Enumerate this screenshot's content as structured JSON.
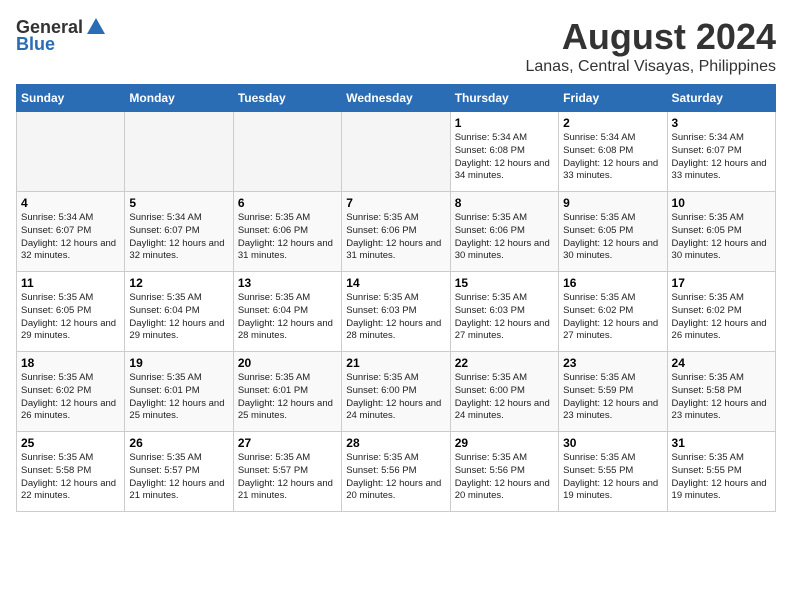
{
  "logo": {
    "general": "General",
    "blue": "Blue"
  },
  "title": "August 2024",
  "location": "Lanas, Central Visayas, Philippines",
  "days_of_week": [
    "Sunday",
    "Monday",
    "Tuesday",
    "Wednesday",
    "Thursday",
    "Friday",
    "Saturday"
  ],
  "weeks": [
    [
      {
        "day": "",
        "empty": true
      },
      {
        "day": "",
        "empty": true
      },
      {
        "day": "",
        "empty": true
      },
      {
        "day": "",
        "empty": true
      },
      {
        "day": "1",
        "sunrise": "5:34 AM",
        "sunset": "6:08 PM",
        "daylight": "12 hours and 34 minutes."
      },
      {
        "day": "2",
        "sunrise": "5:34 AM",
        "sunset": "6:08 PM",
        "daylight": "12 hours and 33 minutes."
      },
      {
        "day": "3",
        "sunrise": "5:34 AM",
        "sunset": "6:07 PM",
        "daylight": "12 hours and 33 minutes."
      }
    ],
    [
      {
        "day": "4",
        "sunrise": "5:34 AM",
        "sunset": "6:07 PM",
        "daylight": "12 hours and 32 minutes."
      },
      {
        "day": "5",
        "sunrise": "5:34 AM",
        "sunset": "6:07 PM",
        "daylight": "12 hours and 32 minutes."
      },
      {
        "day": "6",
        "sunrise": "5:35 AM",
        "sunset": "6:06 PM",
        "daylight": "12 hours and 31 minutes."
      },
      {
        "day": "7",
        "sunrise": "5:35 AM",
        "sunset": "6:06 PM",
        "daylight": "12 hours and 31 minutes."
      },
      {
        "day": "8",
        "sunrise": "5:35 AM",
        "sunset": "6:06 PM",
        "daylight": "12 hours and 30 minutes."
      },
      {
        "day": "9",
        "sunrise": "5:35 AM",
        "sunset": "6:05 PM",
        "daylight": "12 hours and 30 minutes."
      },
      {
        "day": "10",
        "sunrise": "5:35 AM",
        "sunset": "6:05 PM",
        "daylight": "12 hours and 30 minutes."
      }
    ],
    [
      {
        "day": "11",
        "sunrise": "5:35 AM",
        "sunset": "6:05 PM",
        "daylight": "12 hours and 29 minutes."
      },
      {
        "day": "12",
        "sunrise": "5:35 AM",
        "sunset": "6:04 PM",
        "daylight": "12 hours and 29 minutes."
      },
      {
        "day": "13",
        "sunrise": "5:35 AM",
        "sunset": "6:04 PM",
        "daylight": "12 hours and 28 minutes."
      },
      {
        "day": "14",
        "sunrise": "5:35 AM",
        "sunset": "6:03 PM",
        "daylight": "12 hours and 28 minutes."
      },
      {
        "day": "15",
        "sunrise": "5:35 AM",
        "sunset": "6:03 PM",
        "daylight": "12 hours and 27 minutes."
      },
      {
        "day": "16",
        "sunrise": "5:35 AM",
        "sunset": "6:02 PM",
        "daylight": "12 hours and 27 minutes."
      },
      {
        "day": "17",
        "sunrise": "5:35 AM",
        "sunset": "6:02 PM",
        "daylight": "12 hours and 26 minutes."
      }
    ],
    [
      {
        "day": "18",
        "sunrise": "5:35 AM",
        "sunset": "6:02 PM",
        "daylight": "12 hours and 26 minutes."
      },
      {
        "day": "19",
        "sunrise": "5:35 AM",
        "sunset": "6:01 PM",
        "daylight": "12 hours and 25 minutes."
      },
      {
        "day": "20",
        "sunrise": "5:35 AM",
        "sunset": "6:01 PM",
        "daylight": "12 hours and 25 minutes."
      },
      {
        "day": "21",
        "sunrise": "5:35 AM",
        "sunset": "6:00 PM",
        "daylight": "12 hours and 24 minutes."
      },
      {
        "day": "22",
        "sunrise": "5:35 AM",
        "sunset": "6:00 PM",
        "daylight": "12 hours and 24 minutes."
      },
      {
        "day": "23",
        "sunrise": "5:35 AM",
        "sunset": "5:59 PM",
        "daylight": "12 hours and 23 minutes."
      },
      {
        "day": "24",
        "sunrise": "5:35 AM",
        "sunset": "5:58 PM",
        "daylight": "12 hours and 23 minutes."
      }
    ],
    [
      {
        "day": "25",
        "sunrise": "5:35 AM",
        "sunset": "5:58 PM",
        "daylight": "12 hours and 22 minutes."
      },
      {
        "day": "26",
        "sunrise": "5:35 AM",
        "sunset": "5:57 PM",
        "daylight": "12 hours and 21 minutes."
      },
      {
        "day": "27",
        "sunrise": "5:35 AM",
        "sunset": "5:57 PM",
        "daylight": "12 hours and 21 minutes."
      },
      {
        "day": "28",
        "sunrise": "5:35 AM",
        "sunset": "5:56 PM",
        "daylight": "12 hours and 20 minutes."
      },
      {
        "day": "29",
        "sunrise": "5:35 AM",
        "sunset": "5:56 PM",
        "daylight": "12 hours and 20 minutes."
      },
      {
        "day": "30",
        "sunrise": "5:35 AM",
        "sunset": "5:55 PM",
        "daylight": "12 hours and 19 minutes."
      },
      {
        "day": "31",
        "sunrise": "5:35 AM",
        "sunset": "5:55 PM",
        "daylight": "12 hours and 19 minutes."
      }
    ]
  ]
}
